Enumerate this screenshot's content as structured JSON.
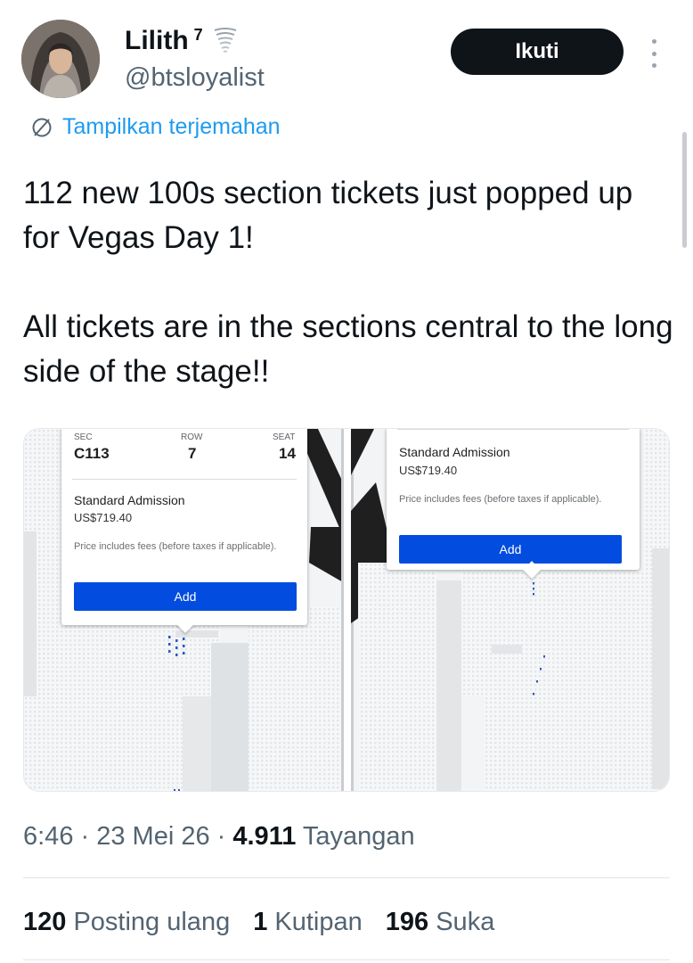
{
  "author": {
    "name": "Lilith",
    "badge": "7",
    "handle": "@btsloyalist",
    "follow_label": "Ikuti"
  },
  "translate_label": "Tampilkan terjemahan",
  "tweet": {
    "paragraph1": "112 new 100s section tickets just popped up for Vegas Day 1!",
    "paragraph2": "All tickets are in the sections central to the long side of the stage!!"
  },
  "media": {
    "left_card": {
      "sec_label": "SEC",
      "sec_value": "C113",
      "row_label": "ROW",
      "row_value": "7",
      "seat_label": "SEAT",
      "seat_value": "14",
      "admission": "Standard Admission",
      "price": "US$719.40",
      "fees_note": "Price includes fees (before taxes if applicable).",
      "add_label": "Add"
    },
    "right_card": {
      "admission": "Standard Admission",
      "price": "US$719.40",
      "fees_note": "Price includes fees (before taxes if applicable).",
      "add_label": "Add"
    },
    "accent_color": "#024ddf"
  },
  "meta": {
    "time": "6:46",
    "date": "23 Mei 26",
    "views_count": "4.911",
    "views_label": "Tayangan"
  },
  "stats": {
    "reposts_count": "120",
    "reposts_label": "Posting ulang",
    "quotes_count": "1",
    "quotes_label": "Kutipan",
    "likes_count": "196",
    "likes_label": "Suka"
  },
  "colors": {
    "text": "#0f1419",
    "secondary": "#536471",
    "link": "#1d9bf0",
    "button": "#0f1419"
  }
}
